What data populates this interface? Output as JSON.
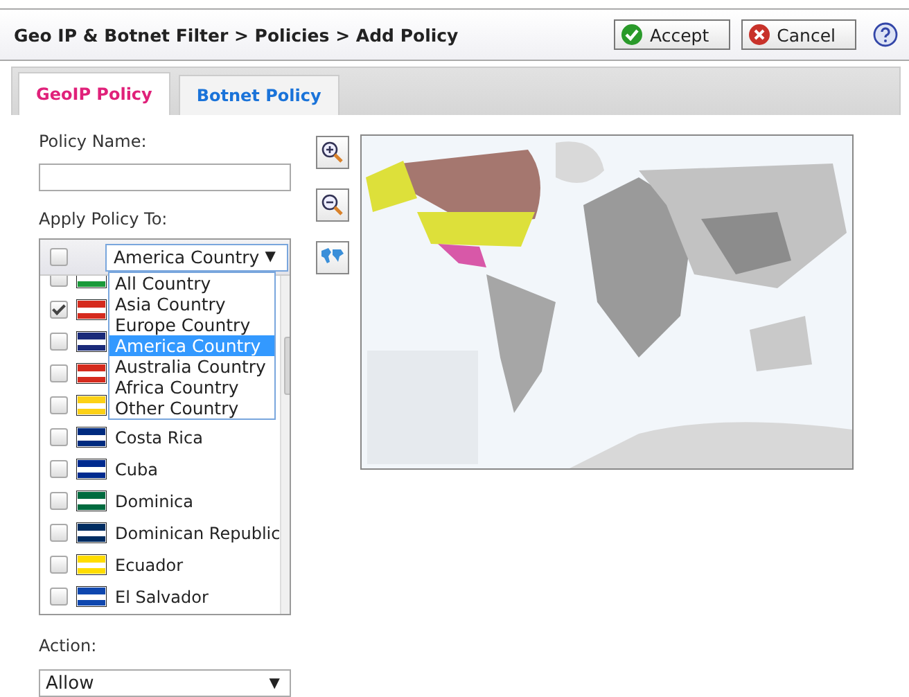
{
  "header": {
    "breadcrumb": "Geo IP & Botnet Filter > Policies > Add Policy",
    "buttons": [
      {
        "kind": "accept",
        "label": "Accept"
      },
      {
        "kind": "cancel",
        "label": "Cancel"
      }
    ]
  },
  "tabs": [
    {
      "label": "GeoIP Policy",
      "selected": true
    },
    {
      "label": "Botnet Policy",
      "selected": false
    }
  ],
  "policy_name": {
    "label": "Policy Name:"
  },
  "apply_to": {
    "label": "Apply Policy To:",
    "all_checked": false,
    "group": "America Country",
    "group_arrow": "▼",
    "dropdown": [
      {
        "label": "All Country",
        "selected": false
      },
      {
        "label": "Asia Country",
        "selected": false
      },
      {
        "label": "Europe Country",
        "selected": false
      },
      {
        "label": "America Country",
        "selected": true
      },
      {
        "label": "Australia Country",
        "selected": false
      },
      {
        "label": "Africa Country",
        "selected": false
      },
      {
        "label": "Other Country",
        "selected": false
      }
    ],
    "countries": [
      {
        "checked": false,
        "color": "#1a9a3a"
      },
      {
        "checked": true,
        "color": "#d52b1e"
      },
      {
        "checked": false,
        "color": "#1a2a7a"
      },
      {
        "checked": false,
        "color": "#d52b1e"
      },
      {
        "checked": false,
        "color": "#fcd116"
      },
      {
        "name": "Costa Rica",
        "checked": false,
        "color": "#002b7f"
      },
      {
        "name": "Cuba",
        "checked": false,
        "color": "#002a8f"
      },
      {
        "name": "Dominica",
        "checked": false,
        "color": "#006b3f"
      },
      {
        "name": "Dominican Republic",
        "checked": false,
        "color": "#002d62"
      },
      {
        "name": "Ecuador",
        "checked": false,
        "color": "#ffdd00"
      },
      {
        "name": "El Salvador",
        "checked": false,
        "color": "#0f47af"
      }
    ]
  },
  "action": {
    "label": "Action:",
    "value": "Allow",
    "arrow": "▼"
  }
}
